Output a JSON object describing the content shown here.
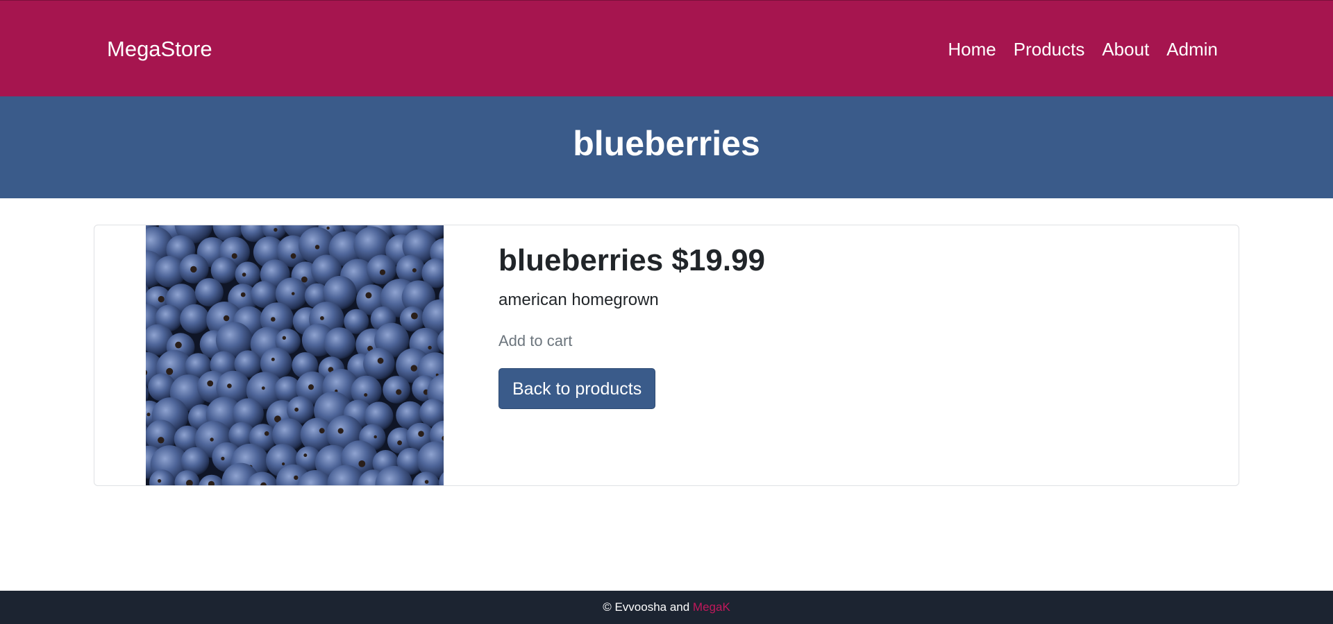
{
  "navbar": {
    "brand": "MegaStore",
    "links": [
      {
        "label": "Home"
      },
      {
        "label": "Products"
      },
      {
        "label": "About"
      },
      {
        "label": "Admin"
      }
    ]
  },
  "hero": {
    "title": "blueberries"
  },
  "product": {
    "heading": "blueberries $19.99",
    "description": "american homegrown",
    "add_to_cart": "Add to cart",
    "back_button": "Back to products",
    "image_subject": "blueberries"
  },
  "footer": {
    "copyright_prefix": "© Evvoosha and",
    "link_label": "MegaK"
  },
  "colors": {
    "navbar": "#a6154f",
    "hero": "#3a5b8a",
    "button": "#3a5b8a",
    "footer": "#1c2431",
    "footer_link": "#c2185b",
    "muted_text": "#6c757d"
  }
}
